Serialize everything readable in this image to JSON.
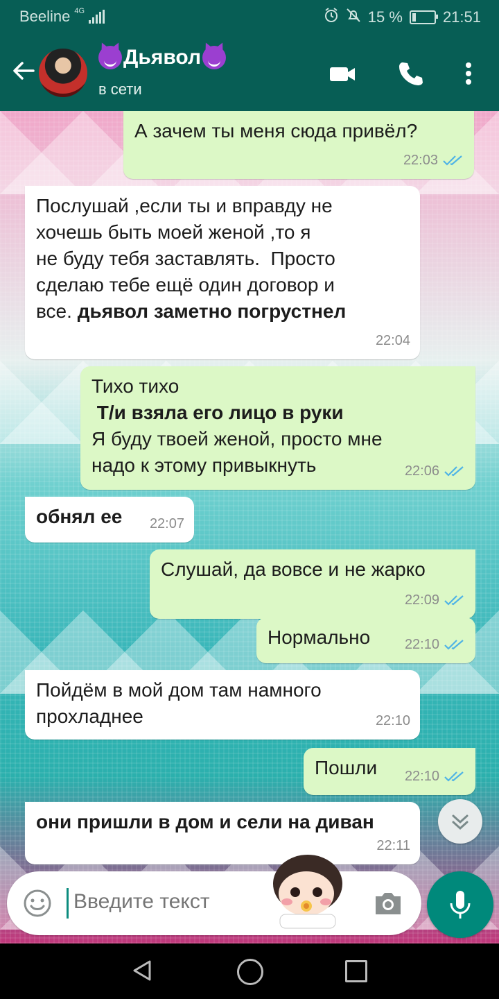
{
  "status_bar": {
    "carrier": "Beeline",
    "network": "4G",
    "battery": "15 %",
    "battery_level": 0.15,
    "time": "21:51"
  },
  "header": {
    "contact_name": "Дьявол",
    "status": "в сети",
    "icons": [
      "back-arrow-icon",
      "video-call-icon",
      "phone-icon",
      "more-vert-icon"
    ]
  },
  "messages": [
    {
      "dir": "out",
      "text": "А зачем ты меня сюда привёл?",
      "time": "22:03",
      "read": true
    },
    {
      "dir": "in",
      "text": "Послушай ,если ты и вправду не\nхочешь быть моей женой ,то я\nне буду тебя заставлять.  Просто\nсделаю тебе ещё один договор и\nвсе. ",
      "bold": "дьявол заметно погрустнел",
      "time": "22:04"
    },
    {
      "dir": "out",
      "lines": [
        "Тихо тихо",
        " Т/и взяла его лицо в руки",
        "Я буду твоей женой, просто мне",
        "надо к этому привыкнуть"
      ],
      "time": "22:06",
      "read": true
    },
    {
      "dir": "in",
      "bold": "обнял ее",
      "time": "22:07"
    },
    {
      "dir": "out",
      "text": "Слушай, да вовсе и не жарко",
      "time": "22:09",
      "read": true
    },
    {
      "dir": "out",
      "text": "Нормально",
      "time": "22:10",
      "read": true
    },
    {
      "dir": "in",
      "text": "Пойдём в мой дом там намного\nпрохладнее",
      "time": "22:10"
    },
    {
      "dir": "out",
      "text": "Пошли",
      "time": "22:10",
      "read": true
    },
    {
      "dir": "in",
      "bold": "они пришли в дом и сели на диван",
      "time": "22:11"
    }
  ],
  "input": {
    "placeholder": "Введите текст",
    "icons": [
      "emoji-icon",
      "camera-icon",
      "mic-icon",
      "scroll-down-icon"
    ]
  },
  "colors": {
    "header": "#075e55",
    "outgoing_bubble": "#dcf8c6",
    "incoming_bubble": "#ffffff",
    "read_tick": "#4fb3e6",
    "mic_button": "#00897b"
  }
}
